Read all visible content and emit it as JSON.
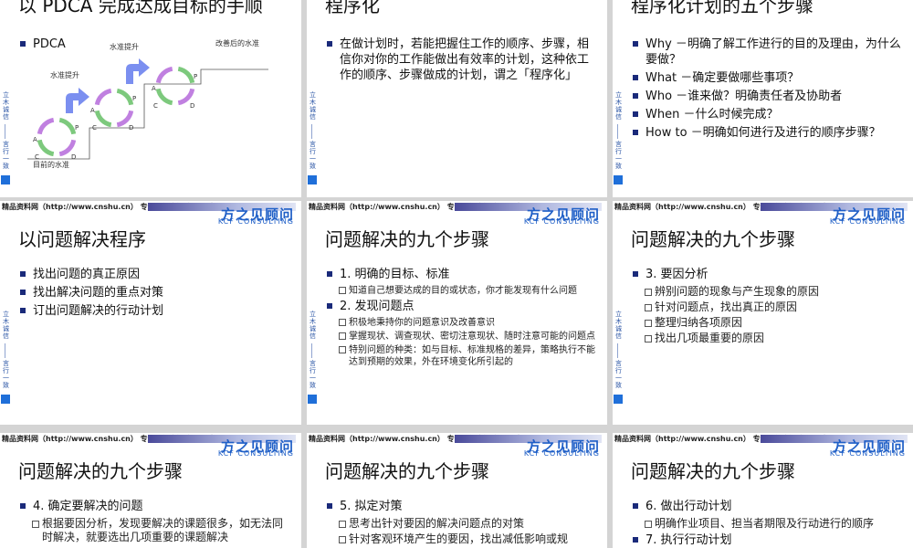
{
  "slides": [
    {
      "title": "以 PDCA 完成达成目标的手顺",
      "bullets": [
        {
          "text": "PDCA",
          "subs": []
        }
      ],
      "diagram": {
        "labels": {
          "current": "目前的水准",
          "raise1": "水准提升",
          "raise2": "水准提升",
          "improved": "改善后的水准"
        },
        "letters": [
          "A",
          "P",
          "C",
          "D"
        ]
      }
    },
    {
      "title": "程序化",
      "bullets": [
        {
          "text": "在做计划时，若能把握住工作的顺序、步骤，相信你对你的工作能做出有效率的计划，这种依工作的顺序、步骤做成的计划，谓之「程序化」",
          "subs": []
        }
      ]
    },
    {
      "title": "程序化计划的五个步骤",
      "bullets": [
        {
          "text": "Why －明确了解工作进行的目的及理由，为什么要做？",
          "subs": []
        },
        {
          "text": "What －确定要做哪些事项？",
          "subs": []
        },
        {
          "text": "Who －谁来做？明确责任者及协助者",
          "subs": []
        },
        {
          "text": "When －什么时候完成？",
          "subs": []
        },
        {
          "text": "How to －明确如何进行及进行的顺序步骤？",
          "subs": []
        }
      ]
    },
    {
      "title": "以问题解决程序",
      "bullets": [
        {
          "text": "找出问题的真正原因",
          "subs": []
        },
        {
          "text": "找出解决问题的重点对策",
          "subs": []
        },
        {
          "text": "订出问题解决的行动计划",
          "subs": []
        }
      ]
    },
    {
      "title": "问题解决的九个步骤",
      "bullets": [
        {
          "text": "1. 明确的目标、标准",
          "subs": [
            "知道自己想要达成的目的或状态，你才能发现有什么问题"
          ]
        },
        {
          "text": "2. 发现问题点",
          "subs": [
            "积极地秉持你的问题意识及改善意识",
            "掌握现状、调查现状、密切注意现状、随时注意可能的问题点",
            "特别问题的种类：如与目标、标准规格的差异，策略执行不能达到预期的效果，外在环境变化所引起的"
          ]
        }
      ]
    },
    {
      "title": "问题解决的九个步骤",
      "bullets": [
        {
          "text": "3. 要因分析",
          "subs": [
            "辨别问题的现象与产生现象的原因",
            "针对问题点，找出真正的原因",
            "整理归纳各项原因",
            "找出几项最重要的原因"
          ]
        }
      ]
    },
    {
      "title": "问题解决的九个步骤",
      "bullets": [
        {
          "text": "4. 确定要解决的问题",
          "subs": [
            "根据要因分析，发现要解决的课题很多，如无法同时解决，就要选出几项重要的课题解决"
          ]
        }
      ]
    },
    {
      "title": "问题解决的九个步骤",
      "bullets": [
        {
          "text": "5. 拟定对策",
          "subs": [
            "思考出针对要因的解决问题点的对策",
            "针对客观环境产生的要因，找出减低影响或规"
          ]
        }
      ]
    },
    {
      "title": "问题解决的九个步骤",
      "bullets": [
        {
          "text": "6. 做出行动计划",
          "subs": [
            "明确作业项目、担当者期限及行动进行的顺序"
          ]
        },
        {
          "text": "7. 执行行动计划",
          "subs": []
        }
      ]
    }
  ],
  "sidebar": {
    "top_text": "立木诚信",
    "bottom_text": "言行一致"
  },
  "footer": {
    "source_text": "精品资料网（http://www.cnshu.cn） 专业提供企管培训资料",
    "brand_cn": "方之见顾问",
    "brand_en": "KCF CONSULTING"
  },
  "colors": {
    "brand": "#1f5fc7",
    "bullet": "#1a2a7a",
    "sidebar": "#2a54a5",
    "arrow": "#7b8ff0"
  }
}
